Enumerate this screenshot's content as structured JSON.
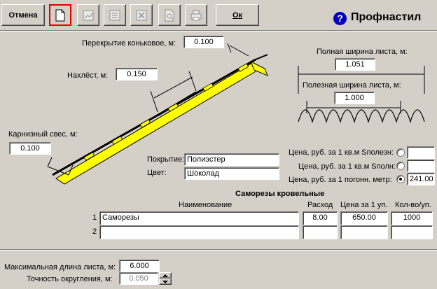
{
  "toolbar": {
    "cancel_label": "Отмена",
    "ok_label": "Ок",
    "icons": [
      "new-document-icon",
      "chart-icon",
      "list-icon",
      "delete-icon",
      "preview-icon",
      "print-icon"
    ]
  },
  "header": {
    "help_icon": "?",
    "title": "Профнастил"
  },
  "diagram": {
    "ridge_label": "Перекрытие коньковое, м:",
    "ridge_value": "0.100",
    "overlap_label": "Нахлёст, м:",
    "overlap_value": "0.150",
    "eaves_label": "Карнизный свес, м:",
    "eaves_value": "0.100",
    "full_width_label": "Полная ширина листа, м:",
    "full_width_value": "1.051",
    "useful_width_label": "Полезная ширина листа, м:",
    "useful_width_value": "1.000"
  },
  "coating": {
    "coating_label": "Покрытие:",
    "coating_value": "Полиэстер",
    "color_label": "Цвет:",
    "color_value": "Шоколад"
  },
  "prices": [
    {
      "label": "Цена, руб. за 1 кв.м Sполезн:",
      "value": "",
      "selected": false
    },
    {
      "label": "Цена, руб. за 1 кв.м Sполн:",
      "value": "",
      "selected": false
    },
    {
      "label": "Цена, руб. за 1 погонн. метр:",
      "value": "241.00",
      "selected": true
    }
  ],
  "screws": {
    "title": "Саморезы кровельные",
    "headers": {
      "name": "Наименование",
      "usage": "Расход",
      "price": "Цена за 1 уп.",
      "qty": "Кол-во/уп."
    },
    "rows": [
      {
        "num": "1",
        "name": "Саморезы",
        "usage": "8.00",
        "price": "650.00",
        "qty": "1000"
      },
      {
        "num": "2",
        "name": "",
        "usage": "",
        "price": "",
        "qty": ""
      }
    ]
  },
  "bottom": {
    "max_length_label": "Максимальная длина листа, м:",
    "max_length_value": "6.000",
    "precision_label": "Точность округления, м:",
    "precision_value": "0.050"
  }
}
